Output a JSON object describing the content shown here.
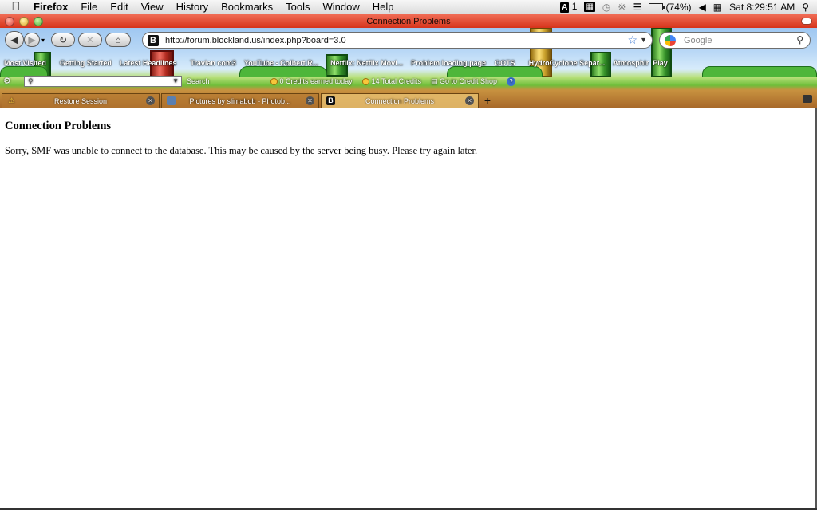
{
  "menubar": {
    "apple_icon": "",
    "app_name": "Firefox",
    "items": [
      "File",
      "Edit",
      "View",
      "History",
      "Bookmarks",
      "Tools",
      "Window",
      "Help"
    ],
    "tray": {
      "adobe_count": "1",
      "battery_percent": "(74%)",
      "battery_level": 0.74,
      "clock": "Sat 8:29:51 AM"
    }
  },
  "window": {
    "title": "Connection Problems"
  },
  "navbar": {
    "url": "http://forum.blockland.us/index.php?board=3.0",
    "search_placeholder": "Google"
  },
  "bookmarks": [
    "Most Visited",
    "Getting Started",
    "Latest Headlines",
    "Travian com3",
    "YouTube - Colbert R...",
    "Netflix: Netflix Movi...",
    "Problem loading page",
    "OOTS",
    "HydroCyclone Separ...",
    "Atmosphir",
    "Play"
  ],
  "addon_toolbar": {
    "search_label": "Search",
    "credits_today": "0 Credits earned today",
    "total_credits": "14 Total Credits",
    "credit_shop": "Go to Credit Shop"
  },
  "tabs": [
    {
      "label": "Restore Session",
      "active": false
    },
    {
      "label": "Pictures by slimabob - Photob...",
      "active": false
    },
    {
      "label": "Connection Problems",
      "active": true
    }
  ],
  "page": {
    "heading": "Connection Problems",
    "message": "Sorry, SMF was unable to connect to the database. This may be caused by the server being busy. Please try again later."
  },
  "colors": {
    "titlebar_red": "#e04a30",
    "theme_green": "#4eb63a"
  }
}
